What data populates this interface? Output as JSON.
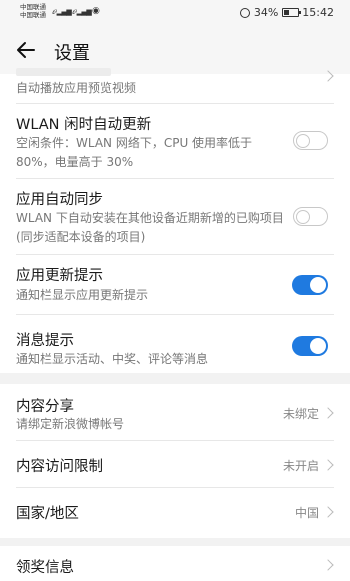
{
  "status_bar": {
    "carrier_1": "中国联通",
    "carrier_2": "中国联通",
    "battery": "34%",
    "battery_level": 0.34,
    "time": "15:42"
  },
  "header": {
    "title": "设置"
  },
  "settings": {
    "autoplay_preview": {
      "subtitle": "自动播放应用预览视频"
    },
    "wlan_update": {
      "label": "WLAN 闲时自动更新",
      "subtitle": "空闲条件：WLAN 网络下，CPU 使用率低于 80%，电量高于 30%",
      "enabled": false
    },
    "app_sync": {
      "label": "应用自动同步",
      "subtitle": "WLAN 下自动安装在其他设备近期新增的已购项目 (同步适配本设备的项目)",
      "enabled": false
    },
    "update_notice": {
      "label": "应用更新提示",
      "subtitle": "通知栏显示应用更新提示",
      "enabled": true
    },
    "message_notice": {
      "label": "消息提示",
      "subtitle": "通知栏显示活动、中奖、评论等消息",
      "enabled": true
    }
  },
  "content": {
    "share": {
      "label": "内容分享",
      "subtitle": "请绑定新浪微博帐号",
      "value": "未绑定"
    },
    "restriction": {
      "label": "内容访问限制",
      "value": "未开启"
    },
    "region": {
      "label": "国家/地区",
      "value": "中国"
    }
  },
  "awards": {
    "label": "领奖信息"
  },
  "colors": {
    "accent": "#1f7ae0",
    "background": "#f2f2f2"
  }
}
